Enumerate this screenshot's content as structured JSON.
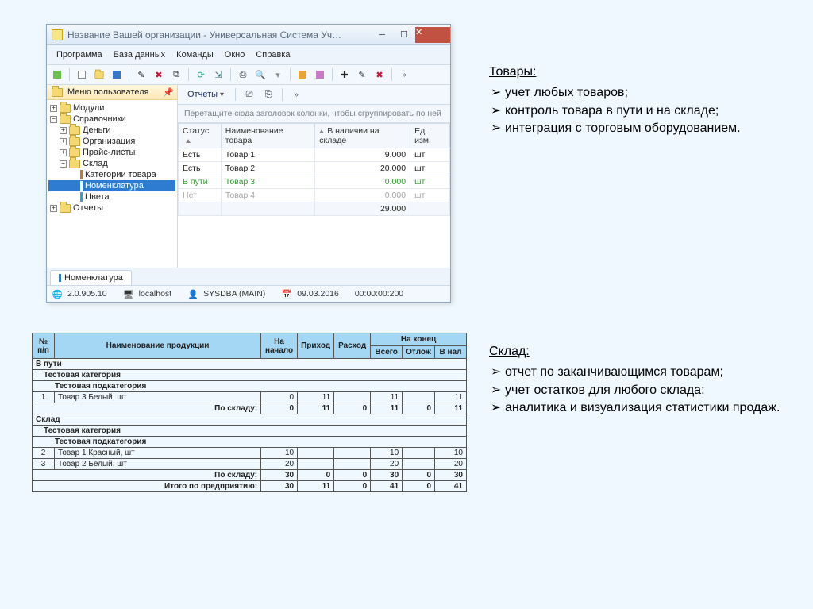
{
  "window": {
    "title": "Название Вашей организации - Универсальная Система Уч…"
  },
  "menu": [
    "Программа",
    "База данных",
    "Команды",
    "Окно",
    "Справка"
  ],
  "sidebar": {
    "header": "Меню пользователя",
    "nodes": {
      "modules": "Модули",
      "spr": "Справочники",
      "money": "Деньги",
      "org": "Организация",
      "price": "Прайс-листы",
      "sklad": "Склад",
      "cat": "Категории товара",
      "nom": "Номенклатура",
      "colors": "Цвета",
      "reports": "Отчеты"
    }
  },
  "maintool": {
    "reports": "Отчеты"
  },
  "grid": {
    "hint": "Перетащите сюда заголовок колонки, чтобы сгруппировать по ней",
    "cols": [
      "Статус",
      "Наименование товара",
      "В наличии на складе",
      "Ед. изм."
    ],
    "rows": [
      {
        "status": "Есть",
        "name": "Товар 1",
        "qty": "9.000",
        "uom": "шт"
      },
      {
        "status": "Есть",
        "name": "Товар 2",
        "qty": "20.000",
        "uom": "шт"
      },
      {
        "status": "В пути",
        "name": "Товар 3",
        "qty": "0.000",
        "uom": "шт",
        "cls": "grn"
      },
      {
        "status": "Нет",
        "name": "Товар 4",
        "qty": "0.000",
        "uom": "шт",
        "cls": "gry"
      }
    ],
    "total": "29.000"
  },
  "tab": "Номенклатура",
  "status": {
    "ver": "2.0.905.10",
    "host": "localhost",
    "user": "SYSDBA (MAIN)",
    "date": "09.03.2016",
    "time": "00:00:00:200"
  },
  "notes1": {
    "title": "Товары:",
    "items": [
      "учет любых товаров;",
      "контроль товара в пути и на складе;",
      "интеграция с торговым оборудованием."
    ]
  },
  "notes2": {
    "title": "Склад:",
    "items": [
      "отчет по заканчивающимся товарам;",
      "учет остатков для любого склада;",
      "аналитика и визуализация статистики продаж."
    ]
  },
  "report": {
    "head": {
      "num": "№ п/п",
      "name": "Наименование продукции",
      "start": "На начало",
      "in": "Приход",
      "out": "Расход",
      "end": "На конец",
      "total": "Всего",
      "hold": "Отлож",
      "avail": "В нал"
    },
    "sections": {
      "s1": "В пути",
      "cat": "Тестовая категория",
      "sub": "Тестовая подкатегория",
      "s2": "Склад",
      "bystock": "По складу:",
      "byent": "Итого по предприятию:"
    },
    "rows": {
      "r1": {
        "n": "1",
        "name": "Товар 3 Белый, шт",
        "a": "0",
        "b": "11",
        "c": "",
        "d": "11",
        "e": "",
        "f": "11"
      },
      "sum1": {
        "a": "0",
        "b": "11",
        "c": "0",
        "d": "11",
        "e": "0",
        "f": "11"
      },
      "r2": {
        "n": "2",
        "name": "Товар 1 Красный, шт",
        "a": "10",
        "b": "",
        "c": "",
        "d": "10",
        "e": "",
        "f": "10"
      },
      "r3": {
        "n": "3",
        "name": "Товар 2 Белый, шт",
        "a": "20",
        "b": "",
        "c": "",
        "d": "20",
        "e": "",
        "f": "20"
      },
      "sum2": {
        "a": "30",
        "b": "0",
        "c": "0",
        "d": "30",
        "e": "0",
        "f": "30"
      },
      "grand": {
        "a": "30",
        "b": "11",
        "c": "0",
        "d": "41",
        "e": "0",
        "f": "41"
      }
    }
  }
}
